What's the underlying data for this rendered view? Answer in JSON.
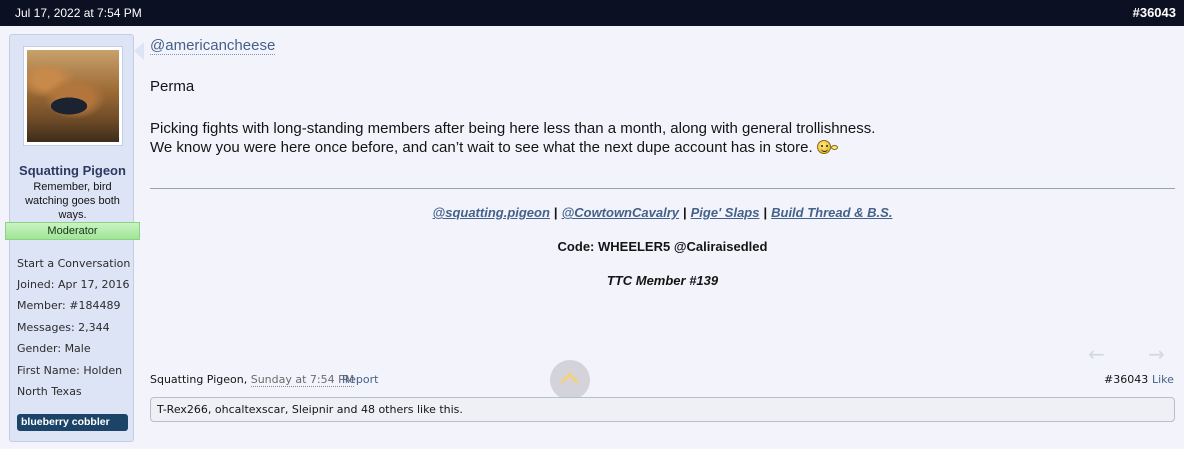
{
  "header": {
    "date": "Jul 17, 2022 at 7:54 PM",
    "post_number": "#36043"
  },
  "user": {
    "name": "Squatting Pigeon",
    "title": "Remember, bird watching goes both ways.",
    "role_badge": "Moderator",
    "start_conversation": "Start a Conversation",
    "joined_label": "Joined:",
    "joined": "Apr 17, 2016",
    "member_label": "Member:",
    "member": "#184489",
    "messages_label": "Messages:",
    "messages": "2,344",
    "gender_label": "Gender:",
    "gender": "Male",
    "first_name_label": "First Name:",
    "first_name": "Holden",
    "location": "North Texas",
    "custom_badge": "blueberry cobbler"
  },
  "post": {
    "mention": "@americancheese",
    "line1": "Perma",
    "line2": "Picking fights with long-standing members after being here less than a month, along with general trollishness.",
    "line3": "We know you were here once before, and can’t wait to see what the next dupe account has in store.",
    "emoji_icon": "smoking-smiley-icon"
  },
  "signature": {
    "links": [
      "@squatting.pigeon",
      "@CowtownCavalry",
      "Pige' Slaps",
      "Build Thread & B.S."
    ],
    "separator": "|",
    "code": "Code: WHEELER5 @Caliraisedled",
    "member": "TTC Member #139"
  },
  "footer": {
    "author": "Squatting Pigeon,",
    "time": "Sunday at 7:54 PM",
    "report": "Report",
    "post_number": "#36043",
    "like": "Like",
    "prev_icon": "arrow-left-icon",
    "next_icon": "arrow-right-icon"
  },
  "likes_summary": "T-Rex266, ohcaltexscar, Sleipnir and 48 others like this."
}
